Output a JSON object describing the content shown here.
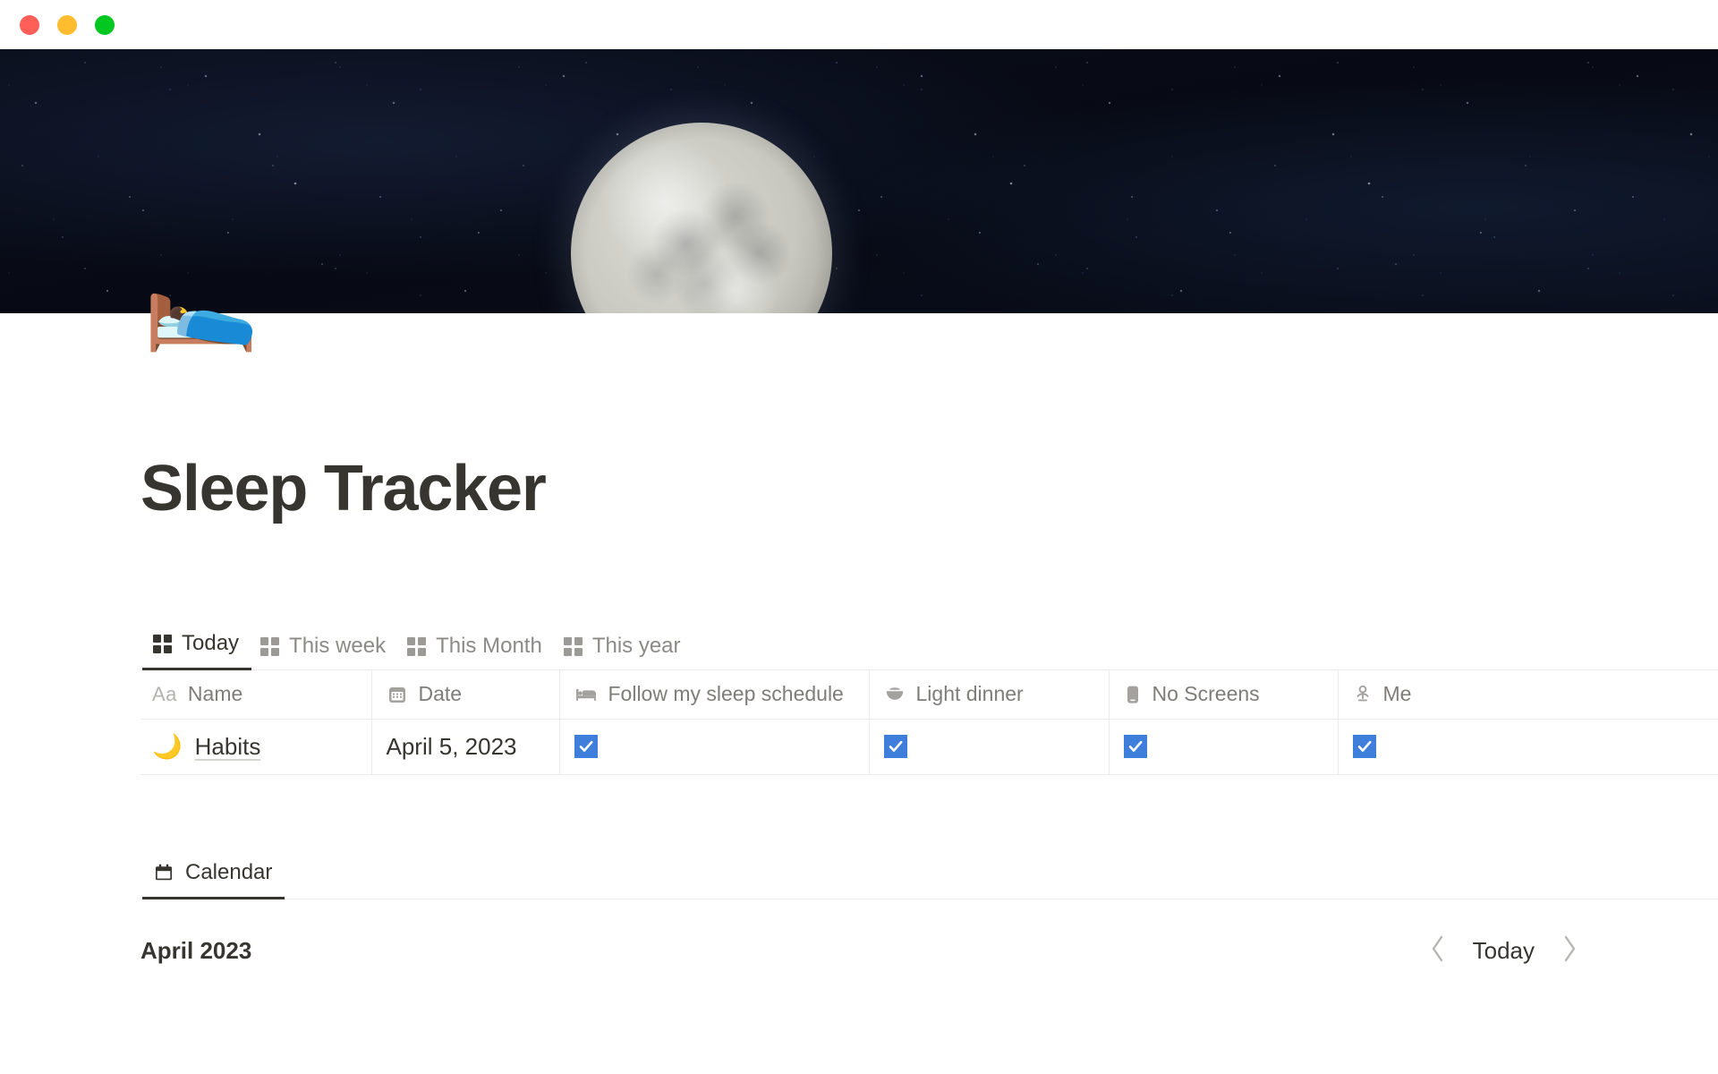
{
  "window": {
    "traffic_lights": [
      {
        "name": "close",
        "color": "#ff5f57"
      },
      {
        "name": "minimize",
        "color": "#febc2e"
      },
      {
        "name": "maximize",
        "color": "#00c821"
      }
    ]
  },
  "cover": {
    "description": "full moon over starry night sky",
    "sky_color": "#070a14",
    "moon_color": "#c7c7c0"
  },
  "page": {
    "icon": "🛌",
    "icon_name": "person-in-bed-emoji",
    "title": "Sleep Tracker"
  },
  "database": {
    "views": [
      {
        "label": "Today",
        "icon": "grid-icon",
        "active": true
      },
      {
        "label": "This week",
        "icon": "grid-icon",
        "active": false
      },
      {
        "label": "This Month",
        "icon": "grid-icon",
        "active": false
      },
      {
        "label": "This year",
        "icon": "grid-icon",
        "active": false
      }
    ],
    "columns": [
      {
        "label": "Name",
        "icon": "title-aa-icon",
        "prefix": "Aa"
      },
      {
        "label": "Date",
        "icon": "calendar-icon"
      },
      {
        "label": "Follow my sleep schedule",
        "icon": "bed-icon"
      },
      {
        "label": "Light dinner",
        "icon": "bowl-icon"
      },
      {
        "label": "No Screens",
        "icon": "phone-icon"
      },
      {
        "label": "Me",
        "icon": "meditation-icon",
        "truncated": true
      }
    ],
    "rows": [
      {
        "emoji": "🌙",
        "name": "Habits",
        "date": "April 5, 2023",
        "follow_my_sleep_schedule": true,
        "light_dinner": true,
        "no_screens": true,
        "meditate": true
      }
    ],
    "checkbox_color": "#3f7fdb"
  },
  "calendar": {
    "tabs": [
      {
        "label": "Calendar",
        "icon": "calendar-icon",
        "active": true
      }
    ],
    "month": "April 2023",
    "nav": {
      "previous": "chevron-left-icon",
      "today_label": "Today",
      "next": "chevron-right-icon"
    }
  }
}
